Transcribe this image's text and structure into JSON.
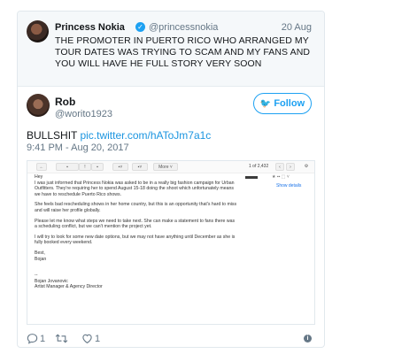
{
  "quoted_tweet": {
    "name": "Princess Nokia",
    "handle": "@princessnokia",
    "date": "20 Aug",
    "text": "THE PROMOTER IN PUERTO RICO WHO ARRANGED MY TOUR DATES WAS TRYING TO SCAM AND MY FANS AND YOU WILL HAVE HE FULL STORY VERY SOON",
    "verified_icon": "verified-badge-icon"
  },
  "tweet": {
    "name": "Rob",
    "handle": "@worito1923",
    "follow_label": "Follow",
    "text_prefix": "BULLSHIT ",
    "link": "pic.twitter.com/hAToJm7a1c",
    "timestamp": "9:41 PM - Aug 20, 2017",
    "reply_count": "1",
    "like_count": "1"
  },
  "email": {
    "toolbar": {
      "more_label": "More ˅",
      "count": "1 of 2,432"
    },
    "show_details": "Show details",
    "greeting": "Hey",
    "paragraphs": [
      "I was just informed that Princess Nokia was asked to be in a really big fashion campaign for Urban Outfitters. They're requiring her to spend August 15-18 doing the shoot which unfortunately means we have to reschedule Puerto Rico shows.",
      "She feels bad rescheduling shows in her home country, but this is an opportunity that's hard to miss and will raise her profile globally.",
      "Please let me know what steps we need to take next. She can make a statement to fans there was a scheduling conflict, but we can't mention the project yet.",
      "I will try to look for some new date options, but we may not have anything until December as she is fully booked every weekend."
    ],
    "signoff": "Best,",
    "signoff_name": "Bojan",
    "signature_dash": "--",
    "signature_name": "Bojan Jovanovic",
    "signature_title": "Artist Manager & Agency Director"
  },
  "colors": {
    "accent": "#1da1f2",
    "link": "#1b95e0",
    "muted": "#657786"
  }
}
